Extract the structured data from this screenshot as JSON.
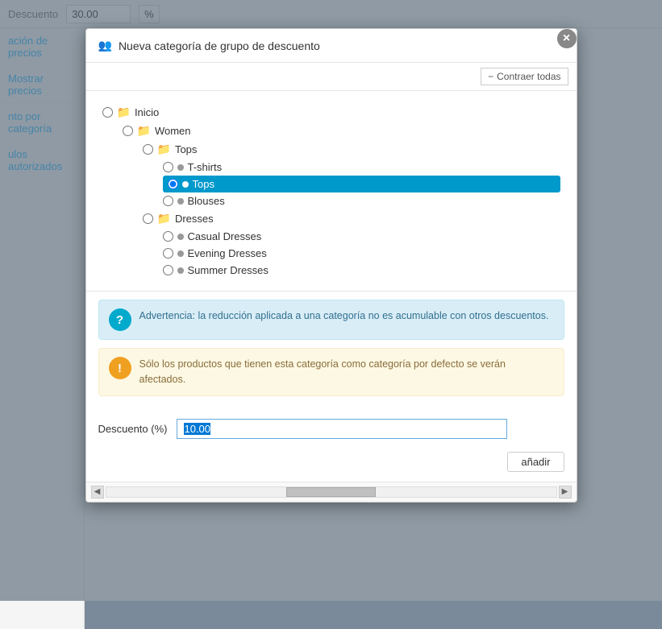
{
  "background": {
    "top_bar": {
      "label": "Descuento",
      "value": "30.00",
      "percent": "%"
    },
    "sidebar_items": [
      "ación de precios",
      "Mostrar precios",
      "nto por categoría",
      "ulos autorizados"
    ]
  },
  "modal": {
    "close_label": "×",
    "header": {
      "icon": "👥",
      "title": "Nueva categoría de grupo de descuento"
    },
    "collapse_button": "Contraer todas",
    "collapse_icon": "−",
    "tree": {
      "items": [
        {
          "level": 0,
          "type": "folder",
          "label": "Inicio",
          "selected": false
        },
        {
          "level": 1,
          "type": "folder",
          "label": "Women",
          "selected": false
        },
        {
          "level": 2,
          "type": "folder",
          "label": "Tops",
          "selected": false
        },
        {
          "level": 3,
          "type": "dot",
          "label": "T-shirts",
          "selected": false
        },
        {
          "level": 3,
          "type": "dot",
          "label": "Tops",
          "selected": true
        },
        {
          "level": 3,
          "type": "dot",
          "label": "Blouses",
          "selected": false
        },
        {
          "level": 2,
          "type": "folder",
          "label": "Dresses",
          "selected": false
        },
        {
          "level": 3,
          "type": "dot",
          "label": "Casual Dresses",
          "selected": false
        },
        {
          "level": 3,
          "type": "dot",
          "label": "Evening Dresses",
          "selected": false
        },
        {
          "level": 3,
          "type": "dot",
          "label": "Summer Dresses",
          "selected": false
        }
      ]
    },
    "info_blue": {
      "icon": "?",
      "text": "Advertencia: la reducción aplicada a una categoría no es acumulable con otros descuentos."
    },
    "info_orange": {
      "icon": "!",
      "text": "Sólo los productos que tienen esta categoría como categoría por defecto se verán afectados."
    },
    "discount_label": "Descuento (%)",
    "discount_value": "10.00",
    "add_button": "añadir"
  }
}
